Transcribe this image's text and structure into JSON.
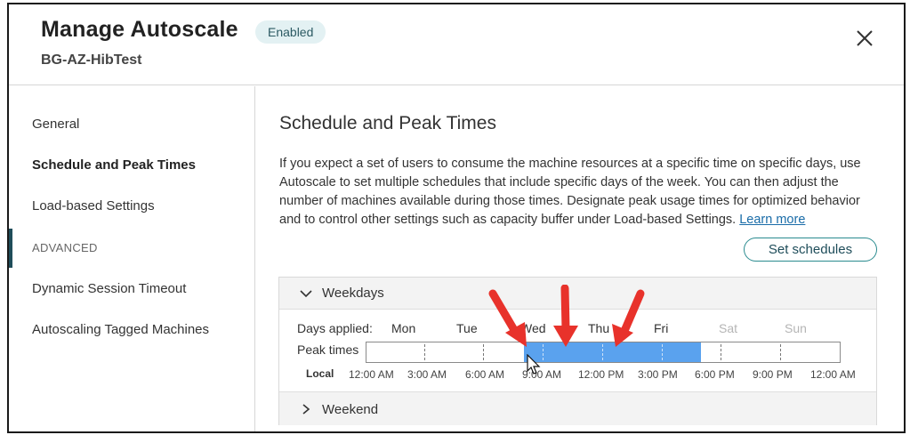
{
  "header": {
    "title": "Manage Autoscale",
    "badge": "Enabled",
    "subtitle": "BG-AZ-HibTest",
    "close_icon": "close-icon"
  },
  "sidebar": {
    "items": [
      {
        "label": "General",
        "active": false
      },
      {
        "label": "Schedule and Peak Times",
        "active": true
      },
      {
        "label": "Load-based Settings",
        "active": false
      }
    ],
    "section_label": "ADVANCED",
    "advanced_items": [
      {
        "label": "Dynamic Session Timeout"
      },
      {
        "label": "Autoscaling Tagged Machines"
      }
    ]
  },
  "main": {
    "title": "Schedule and Peak Times",
    "description": "If you expect a set of users to consume the machine resources at a specific time on specific days, use Autoscale to set multiple schedules that include specific days of the week. You can then adjust the number of machines available during those times. Designate peak usage times for optimized behavior and to control other settings such as capacity buffer under Load-based Settings.",
    "learn_more": "Learn more",
    "set_schedules_button": "Set schedules",
    "schedules": [
      {
        "name": "Weekdays",
        "expanded": true,
        "days_applied_label": "Days applied:",
        "days": [
          {
            "label": "Mon",
            "applied": true
          },
          {
            "label": "Tue",
            "applied": true
          },
          {
            "label": "Wed",
            "applied": true
          },
          {
            "label": "Thu",
            "applied": true
          },
          {
            "label": "Fri",
            "applied": true
          },
          {
            "label": "Sat",
            "applied": false
          },
          {
            "label": "Sun",
            "applied": false
          }
        ],
        "peak_times_label": "Peak times",
        "peak_range_fraction": {
          "start": 0.333,
          "end": 0.708
        },
        "timezone_label": "Local",
        "time_ticks": [
          "12:00 AM",
          "3:00 AM",
          "6:00 AM",
          "9:00 AM",
          "12:00 PM",
          "3:00 PM",
          "6:00 PM",
          "9:00 PM",
          "12:00 AM"
        ]
      },
      {
        "name": "Weekend",
        "expanded": false
      }
    ]
  },
  "colors": {
    "accent": "#2a8b8f",
    "peak_fill": "#5aa2ee",
    "annotation_arrow": "#e8322b",
    "badge_bg": "#e3f1f3"
  }
}
